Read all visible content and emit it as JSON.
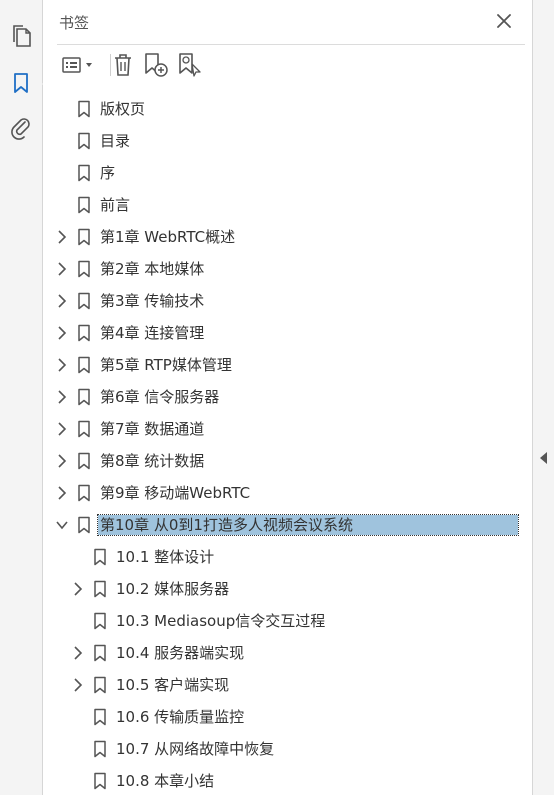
{
  "panel": {
    "title": "书签",
    "close_icon": "close-icon"
  },
  "rail": [
    {
      "name": "pages-icon"
    },
    {
      "name": "bookmark-icon",
      "active": true
    },
    {
      "name": "attachment-icon"
    }
  ],
  "toolbar": [
    {
      "name": "options-menu-icon"
    },
    {
      "name": "delete-icon"
    },
    {
      "name": "new-bookmark-icon"
    },
    {
      "name": "find-bookmark-icon"
    }
  ],
  "colors": {
    "selection": "#9fc3dd",
    "rail": "#f4f4f4",
    "text": "#333333"
  },
  "bookmarks": [
    {
      "label": "版权页",
      "level": 0,
      "expandable": false
    },
    {
      "label": "目录",
      "level": 0,
      "expandable": false
    },
    {
      "label": "序",
      "level": 0,
      "expandable": false
    },
    {
      "label": "前言",
      "level": 0,
      "expandable": false
    },
    {
      "label": "第1章 WebRTC概述",
      "level": 0,
      "expandable": true,
      "expanded": false
    },
    {
      "label": "第2章 本地媒体",
      "level": 0,
      "expandable": true,
      "expanded": false
    },
    {
      "label": "第3章 传输技术",
      "level": 0,
      "expandable": true,
      "expanded": false
    },
    {
      "label": "第4章 连接管理",
      "level": 0,
      "expandable": true,
      "expanded": false
    },
    {
      "label": "第5章 RTP媒体管理",
      "level": 0,
      "expandable": true,
      "expanded": false
    },
    {
      "label": "第6章 信令服务器",
      "level": 0,
      "expandable": true,
      "expanded": false
    },
    {
      "label": "第7章 数据通道",
      "level": 0,
      "expandable": true,
      "expanded": false
    },
    {
      "label": "第8章 统计数据",
      "level": 0,
      "expandable": true,
      "expanded": false
    },
    {
      "label": "第9章 移动端WebRTC",
      "level": 0,
      "expandable": true,
      "expanded": false
    },
    {
      "label": "第10章 从0到1打造多人视频会议系统",
      "level": 0,
      "expandable": true,
      "expanded": true,
      "selected": true
    },
    {
      "label": "10.1 整体设计",
      "level": 1,
      "expandable": false
    },
    {
      "label": "10.2 媒体服务器",
      "level": 1,
      "expandable": true,
      "expanded": false
    },
    {
      "label": "10.3 Mediasoup信令交互过程",
      "level": 1,
      "expandable": false
    },
    {
      "label": "10.4 服务器端实现",
      "level": 1,
      "expandable": true,
      "expanded": false
    },
    {
      "label": "10.5 客户端实现",
      "level": 1,
      "expandable": true,
      "expanded": false
    },
    {
      "label": "10.6 传输质量监控",
      "level": 1,
      "expandable": false
    },
    {
      "label": "10.7 从网络故障中恢复",
      "level": 1,
      "expandable": false
    },
    {
      "label": "10.8 本章小结",
      "level": 1,
      "expandable": false
    }
  ]
}
